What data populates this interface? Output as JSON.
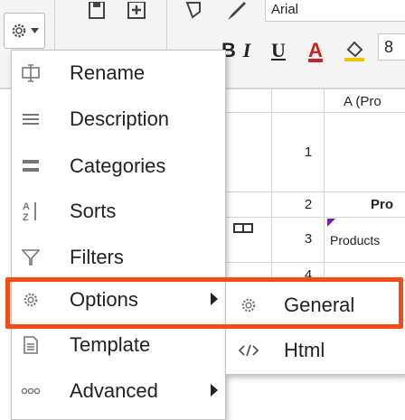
{
  "toolbar": {
    "font_name": "Arial",
    "font_size": "8",
    "underline_label": "U",
    "color_label": "A",
    "italic_label": "I",
    "bold_label": "B"
  },
  "grid": {
    "column_header": "A (Pro",
    "rows": [
      {
        "num": "1",
        "text": ""
      },
      {
        "num": "2",
        "text": "Pro"
      },
      {
        "num": "3",
        "text": "Products"
      },
      {
        "num": "4",
        "text": ""
      }
    ]
  },
  "menu": {
    "items": [
      {
        "label": "Rename",
        "icon": "rename-icon",
        "submenu": false
      },
      {
        "label": "Description",
        "icon": "description-icon",
        "submenu": false
      },
      {
        "label": "Categories",
        "icon": "categories-icon",
        "submenu": false
      },
      {
        "label": "Sorts",
        "icon": "sort-az-icon",
        "submenu": false
      },
      {
        "label": "Filters",
        "icon": "filter-icon",
        "submenu": false
      },
      {
        "label": "Options",
        "icon": "gear-icon",
        "submenu": true
      },
      {
        "label": "Template",
        "icon": "template-icon",
        "submenu": false
      },
      {
        "label": "Advanced",
        "icon": "more-dots-icon",
        "submenu": true
      }
    ]
  },
  "submenu": {
    "items": [
      {
        "label": "General",
        "icon": "gear-icon"
      },
      {
        "label": "Html",
        "icon": "code-icon"
      }
    ]
  },
  "colors": {
    "highlight": "#f04e12",
    "accent_text": "#cc1f1f",
    "corner_marker": "#7a1fa2"
  }
}
